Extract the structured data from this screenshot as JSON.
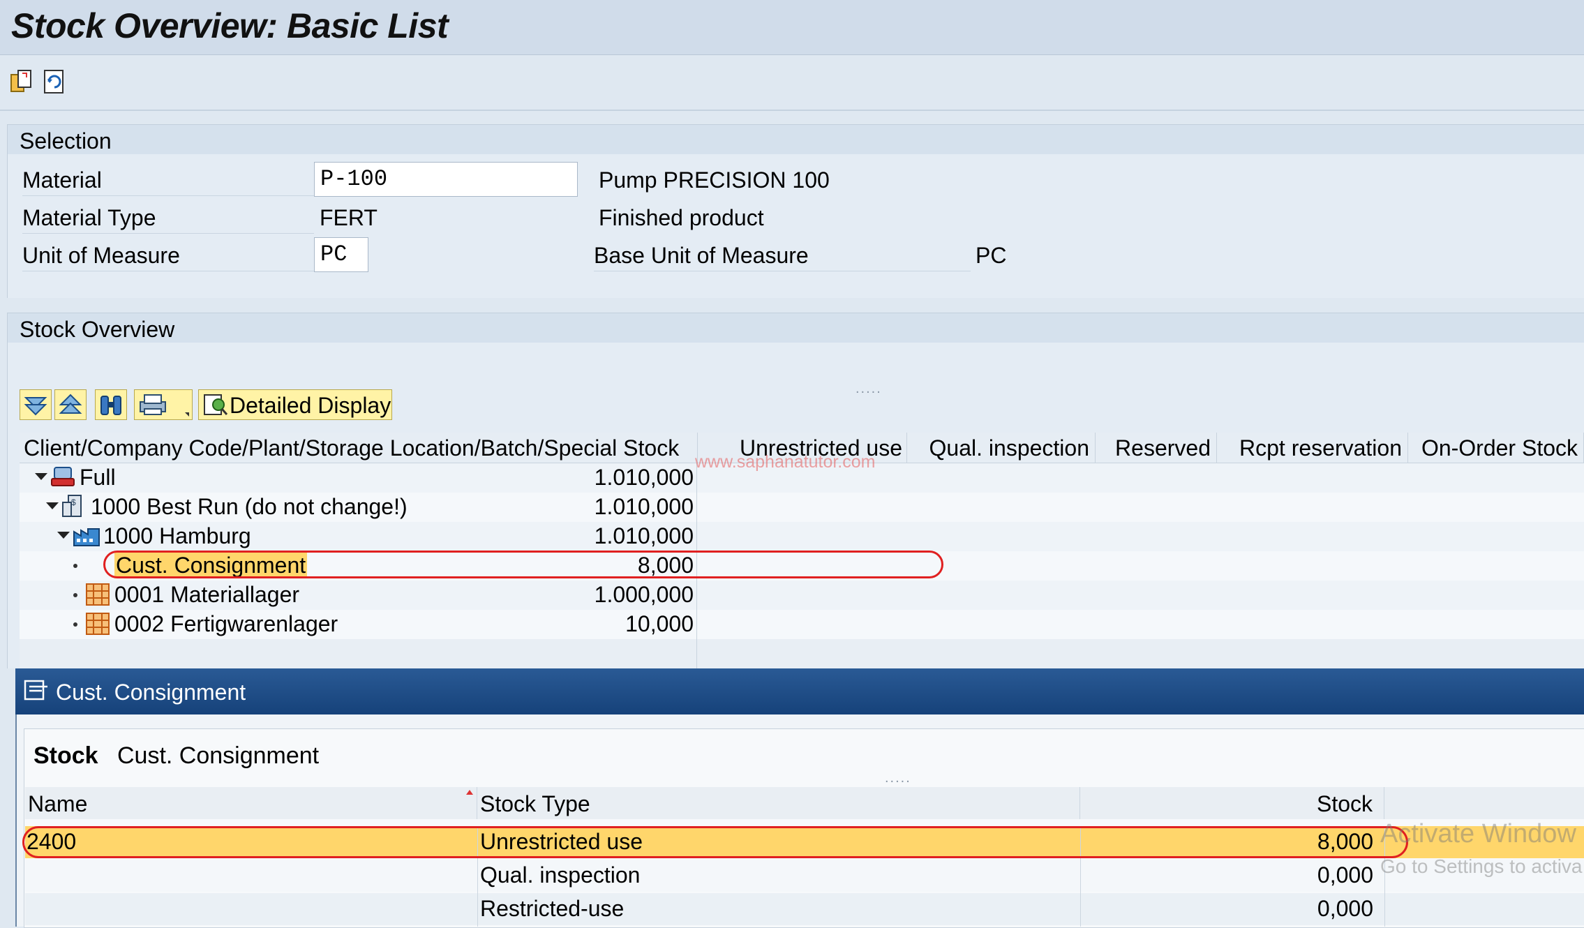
{
  "window": {
    "title": "Stock Overview: Basic List"
  },
  "toolbar": {
    "icons": [
      "copy-icon",
      "refresh-icon"
    ]
  },
  "selection": {
    "header": "Selection",
    "material_label": "Material",
    "material_value": "P-100",
    "material_desc": "Pump PRECISION 100",
    "material_type_label": "Material Type",
    "material_type_value": "FERT",
    "material_type_desc": "Finished product",
    "uom_label": "Unit of Measure",
    "uom_value": "PC",
    "base_uom_label": "Base Unit of Measure",
    "base_uom_value": "PC"
  },
  "stock_overview": {
    "header": "Stock Overview",
    "detailed_display_label": "Detailed Display",
    "columns": [
      "Client/Company Code/Plant/Storage Location/Batch/Special Stock",
      "Unrestricted use",
      "Qual. inspection",
      "Reserved",
      "Rcpt reservation",
      "On-Order Stock"
    ],
    "rows": [
      {
        "label": "Full",
        "unrestricted": "1.010,000"
      },
      {
        "label": "1000 Best Run (do not change!)",
        "unrestricted": "1.010,000"
      },
      {
        "label": "1000 Hamburg",
        "unrestricted": "1.010,000"
      },
      {
        "label": "Cust. Consignment",
        "unrestricted": "8,000"
      },
      {
        "label": "0001 Materiallager",
        "unrestricted": "1.000,000"
      },
      {
        "label": "0002 Fertigwarenlager",
        "unrestricted": "10,000"
      }
    ],
    "watermark": "www.saphanatutor.com"
  },
  "popup": {
    "title": "Cust. Consignment",
    "stock_label": "Stock",
    "stock_value": "Cust. Consignment",
    "columns": [
      "Name",
      "Stock Type",
      "Stock"
    ],
    "rows": [
      {
        "name": "2400",
        "type": "Unrestricted use",
        "stock": "8,000"
      },
      {
        "name": "",
        "type": "Qual. inspection",
        "stock": "0,000"
      },
      {
        "name": "",
        "type": "Restricted-use",
        "stock": "0,000"
      }
    ]
  },
  "os_overlay": {
    "line1": "Activate Window",
    "line2": "Go to Settings to activa"
  },
  "colors": {
    "highlight": "#ffd66b",
    "popup_title": "#1e4d89",
    "annotation": "#e02020"
  }
}
